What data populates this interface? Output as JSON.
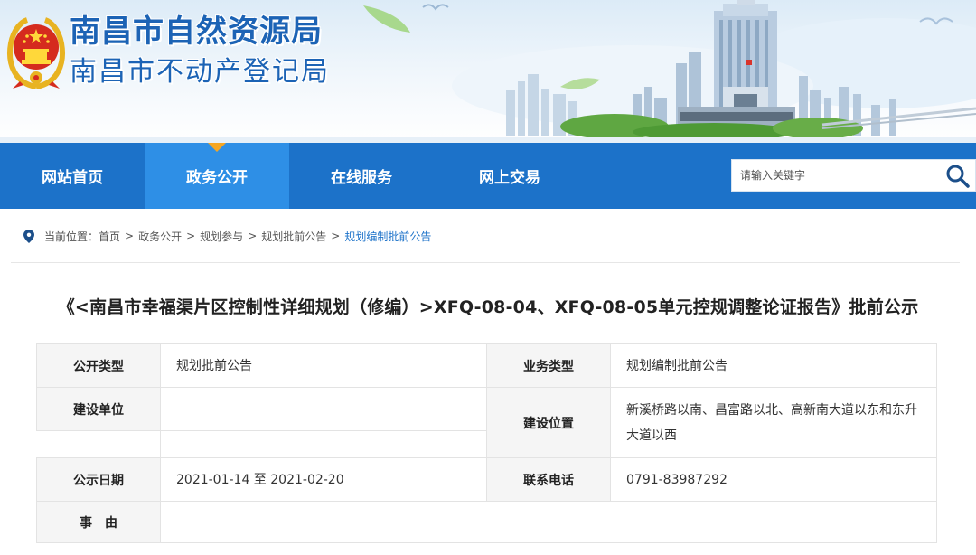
{
  "header": {
    "title_main": "南昌市自然资源局",
    "title_sub": "南昌市不动产登记局",
    "colors": {
      "brand_blue": "#1c63b5",
      "nav_blue": "#1c72c9",
      "nav_active": "#2e8fe6",
      "accent_orange": "#f5a623"
    }
  },
  "nav": {
    "items": [
      {
        "label": "网站首页",
        "active": false
      },
      {
        "label": "政务公开",
        "active": true
      },
      {
        "label": "在线服务",
        "active": false
      },
      {
        "label": "网上交易",
        "active": false
      }
    ],
    "search": {
      "placeholder": "请输入关键字",
      "icon": "search-icon"
    }
  },
  "breadcrumb": {
    "prefix": "当前位置：",
    "items": [
      "首页",
      "政务公开",
      "规划参与",
      "规划批前公告"
    ],
    "current": "规划编制批前公告",
    "separator": ">"
  },
  "article": {
    "title": "《<南昌市幸福渠片区控制性详细规划（修编）>XFQ-08-04、XFQ-08-05单元控规调整论证报告》批前公示"
  },
  "info_table": {
    "disclosure_type_label": "公开类型",
    "disclosure_type_value": "规划批前公告",
    "business_type_label": "业务类型",
    "business_type_value": "规划编制批前公告",
    "builder_label": "建设单位",
    "builder_value": "",
    "location_label": "建设位置",
    "location_value": "新溪桥路以南、昌富路以北、高新南大道以东和东升大道以西",
    "date_label": "公示日期",
    "date_value": "2021-01-14 至 2021-02-20",
    "phone_label": "联系电话",
    "phone_value": "0791-83987292",
    "reason_label": "事　由",
    "reason_value": ""
  }
}
